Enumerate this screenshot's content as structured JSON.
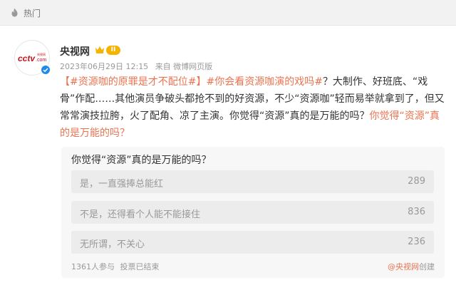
{
  "hot_bar": {
    "label": "热门",
    "icon": "flame-icon"
  },
  "user": {
    "name": "央视网",
    "avatar_text": "CCTV.com",
    "avatar_subtext": "央视网",
    "level": "II",
    "verified": true
  },
  "meta": {
    "date": "2023年06月29日 12:15",
    "source": "来自 微博网页版"
  },
  "post": {
    "tag1": "【#资源咖的原罪是才不配位#】",
    "tag2": "#你会看资源咖演的戏吗#",
    "text": "？大制作、好班底、“戏骨”作配……其他演员争破头都抢不到的好资源，不少“资源咖”轻而易举就拿到了，但又常常演技拉胯，火了配角、凉了主演。你觉得“资源”真的是万能的吗？",
    "link": "你觉得“资源”真的是万能的吗？"
  },
  "vote": {
    "question": "你觉得“资源”真的是万能的吗？",
    "options": [
      {
        "label": "是，一直强捧总能红",
        "count": "289"
      },
      {
        "label": "不是，还得看个人能不能接住",
        "count": "836"
      },
      {
        "label": "无所谓，不关心",
        "count": "236"
      }
    ],
    "participants": "1361人参与",
    "status": "投票已结束",
    "creator": "@央视网",
    "creator_suffix": "创建"
  },
  "colors": {
    "accent": "#eb7350",
    "verified": "#1f8be6",
    "badge": "#f5b400"
  }
}
